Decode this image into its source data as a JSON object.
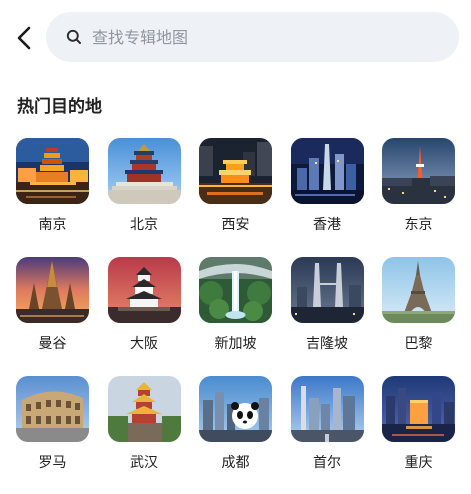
{
  "search": {
    "placeholder": "查找专辑地图"
  },
  "section": {
    "title": "热门目的地"
  },
  "cities": [
    {
      "name": "南京",
      "icon": "pagoda-night-photo"
    },
    {
      "name": "北京",
      "icon": "temple-of-heaven-photo"
    },
    {
      "name": "西安",
      "icon": "xian-night-tower-photo"
    },
    {
      "name": "香港",
      "icon": "hongkong-skyline-photo"
    },
    {
      "name": "东京",
      "icon": "tokyo-tower-photo"
    },
    {
      "name": "曼谷",
      "icon": "bangkok-temple-photo"
    },
    {
      "name": "大阪",
      "icon": "osaka-castle-photo"
    },
    {
      "name": "新加坡",
      "icon": "jewel-waterfall-photo"
    },
    {
      "name": "吉隆坡",
      "icon": "petronas-towers-photo"
    },
    {
      "name": "巴黎",
      "icon": "eiffel-tower-photo"
    },
    {
      "name": "罗马",
      "icon": "colosseum-photo"
    },
    {
      "name": "武汉",
      "icon": "yellow-crane-tower-photo"
    },
    {
      "name": "成都",
      "icon": "panda-city-photo"
    },
    {
      "name": "首尔",
      "icon": "seoul-city-photo"
    },
    {
      "name": "重庆",
      "icon": "chongqing-night-photo"
    }
  ]
}
